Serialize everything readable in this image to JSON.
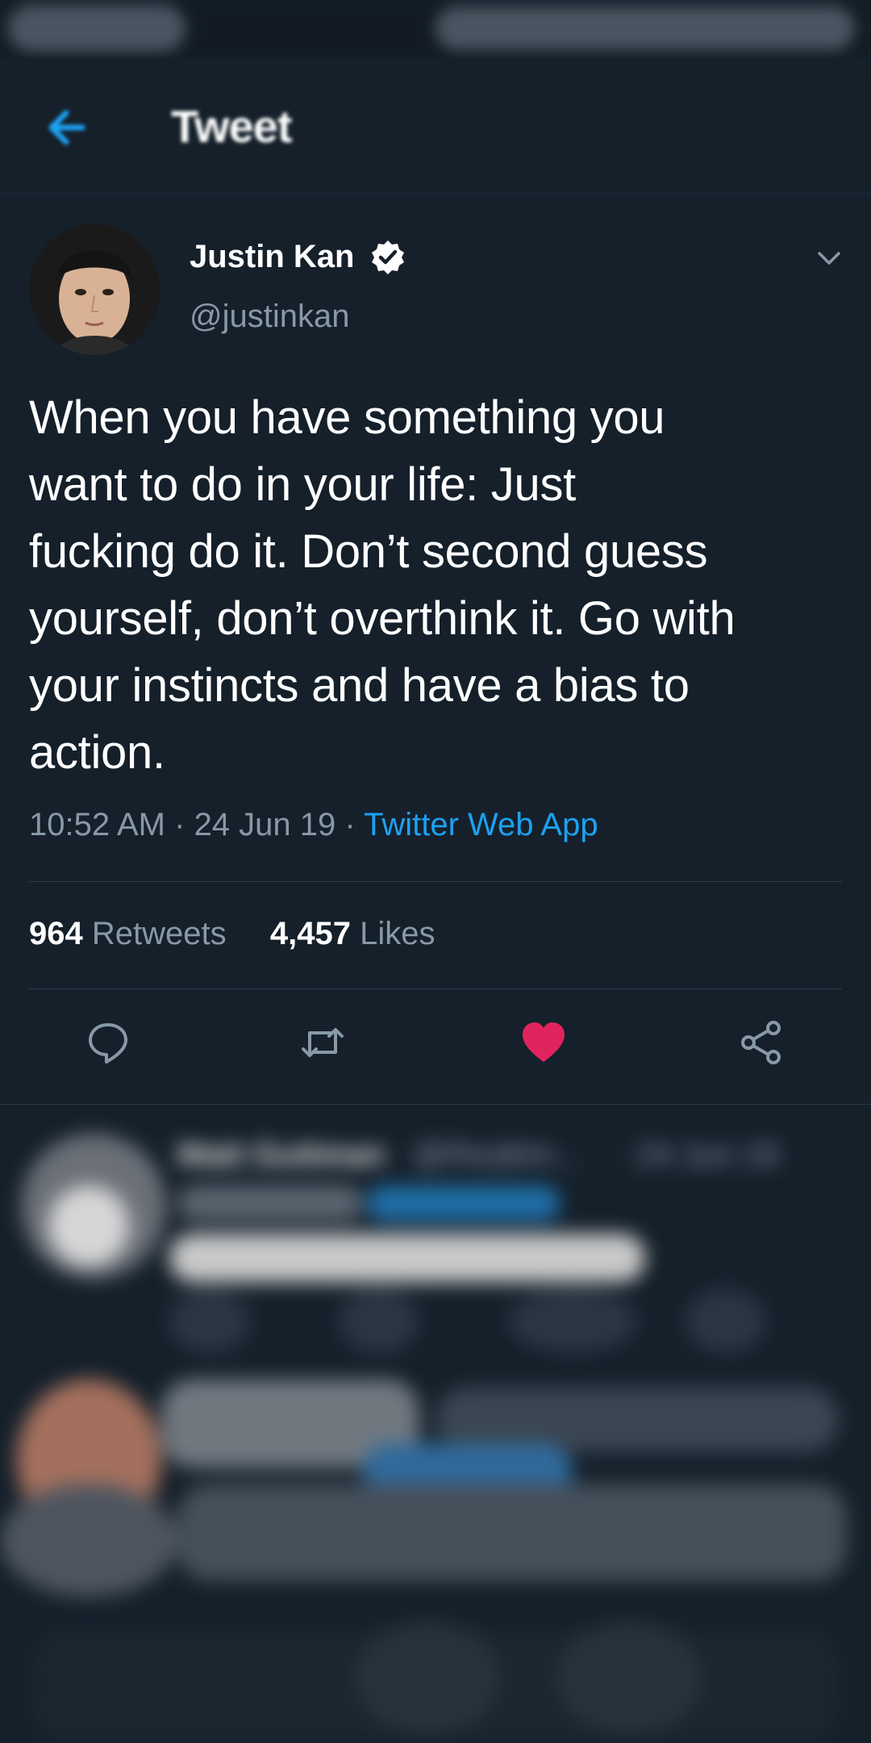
{
  "header": {
    "title": "Tweet"
  },
  "tweet": {
    "author_name": "Justin Kan",
    "author_handle": "@justinkan",
    "text": "When you have something you\nwant to do in your life: Just\nfucking do it. Don’t second guess\nyourself, don’t overthink it. Go with\nyour instincts and have a bias to\naction.",
    "time": "10:52 AM",
    "date": "24 Jun 19",
    "separator": " · ",
    "source": "Twitter Web App",
    "retweet_count": "964",
    "retweets_label": "Retweets",
    "like_count": "4,457",
    "likes_label": "Likes",
    "liked": true
  },
  "reply": {
    "author_name": "Matt Guttman",
    "author_handle": "@Realtim...",
    "date": "· 24 Jun 19"
  },
  "icons": {
    "back": "back-arrow-icon",
    "verified": "verified-badge-icon",
    "caret": "chevron-down-icon",
    "reply": "reply-icon",
    "retweet": "retweet-icon",
    "like": "heart-icon",
    "share": "share-icon"
  },
  "colors": {
    "background": "#15202b",
    "accent": "#1da1f2",
    "like": "#e0245e",
    "secondary_text": "#8899a6"
  }
}
